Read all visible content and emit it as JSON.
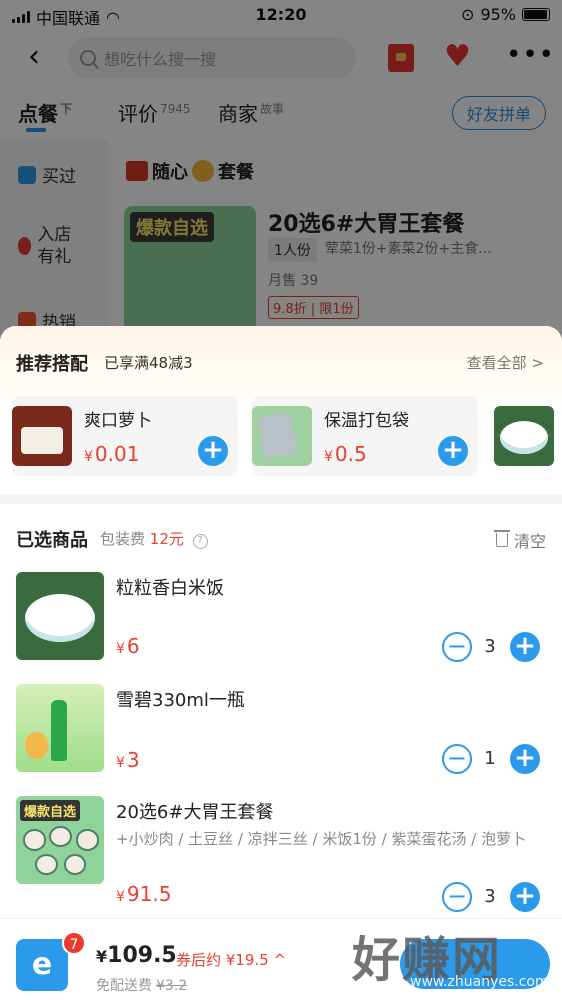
{
  "status_bar": {
    "carrier": "中国联通",
    "time": "12:20",
    "battery": "95%",
    "battery_level": 0.95
  },
  "top_nav": {
    "search_placeholder": "想吃什么搜一搜"
  },
  "tabs": [
    {
      "label": "点餐",
      "sup": "下"
    },
    {
      "label": "评价",
      "sup": "7945"
    },
    {
      "label": "商家",
      "sup": "故事"
    }
  ],
  "friend_button": "好友拼单",
  "sidebar": {
    "items": [
      "买过",
      "入店有礼",
      "热销"
    ]
  },
  "background_product": {
    "section_title": "随心",
    "section_title_suffix": "套餐",
    "image_label": "爆款自选",
    "name": "20选6#大胃王套餐",
    "portion": "1人份",
    "desc": "荤菜1份+素菜2份+主食...",
    "sales": "月售 39",
    "promo": "9.8折 | 限1份"
  },
  "recommend": {
    "title": "推荐搭配",
    "subtitle": "已享满48减3",
    "view_all": "查看全部 >",
    "items": [
      {
        "name": "爽口萝卜",
        "currency": "¥",
        "price": "0.01"
      },
      {
        "name": "保温打包袋",
        "currency": "¥",
        "price": "0.5"
      }
    ]
  },
  "selected": {
    "title": "已选商品",
    "packing_label": "包装费",
    "packing_fee": "12元",
    "clear_label": "清空",
    "items": [
      {
        "name": "粒粒香白米饭",
        "desc": "",
        "currency": "¥",
        "price": "6",
        "qty": "3"
      },
      {
        "name": "雪碧330ml一瓶",
        "desc": "",
        "currency": "¥",
        "price": "3",
        "qty": "1"
      },
      {
        "name": "20选6#大胃王套餐",
        "desc": "+小炒肉 / 土豆丝 / 凉拌三丝 / 米饭1份 / 紫菜蛋花汤 / 泡萝卜",
        "currency": "¥",
        "price": "91.5",
        "qty": "3",
        "image_label": "爆款自选"
      }
    ]
  },
  "bottom_bar": {
    "cart_count": "7",
    "total_currency": "¥",
    "total": "109.5",
    "after_coupon": "券后约 ¥19.5 ^",
    "free_delivery": "免配送费",
    "original_delivery": "¥3.2"
  },
  "watermark": {
    "text": "好赚网",
    "url": "www.zhuanyes.com"
  },
  "colors": {
    "accent": "#2b9aea",
    "price": "#e9402f",
    "overlay": "rgba(0,0,0,0.48)"
  }
}
